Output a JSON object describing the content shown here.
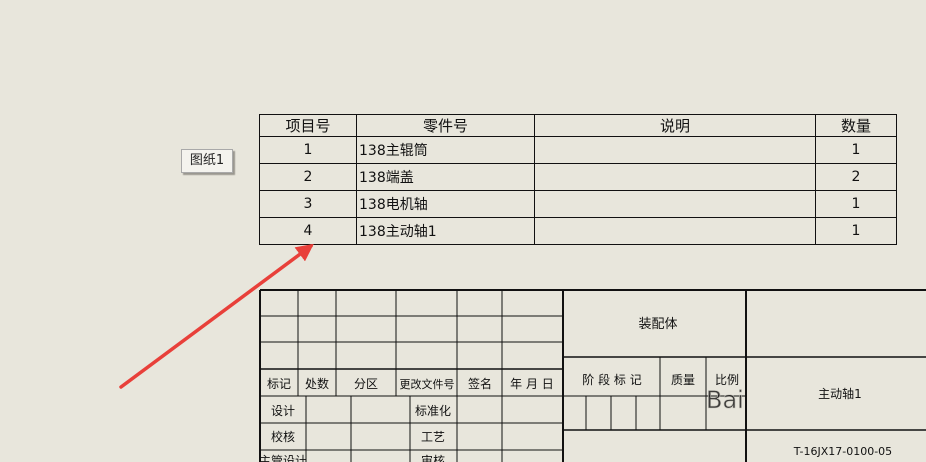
{
  "sheet_tab": {
    "label": "图纸1"
  },
  "bom": {
    "headers": [
      "项目号",
      "零件号",
      "说明",
      "数量"
    ],
    "rows": [
      {
        "item": "1",
        "part": "138主辊筒",
        "desc": "",
        "qty": "1"
      },
      {
        "item": "2",
        "part": "138端盖",
        "desc": "",
        "qty": "2"
      },
      {
        "item": "3",
        "part": "138电机轴",
        "desc": "",
        "qty": "1"
      },
      {
        "item": "4",
        "part": "138主动轴1",
        "desc": "",
        "qty": "1"
      }
    ]
  },
  "title_block": {
    "header_row": [
      "标记",
      "处数",
      "分区",
      "更改文件号",
      "签名",
      "年 月 日"
    ],
    "left_labels": [
      "设计",
      "校核",
      "主管设计"
    ],
    "mid_labels": [
      "标准化",
      "工艺",
      "审核"
    ],
    "assembly": "装配体",
    "stage_mark": "阶 段 标 记",
    "mass": "质量",
    "scale": "比例",
    "drawing_name": "主动轴1",
    "drawing_number": "T-16JX17-0100-05"
  },
  "watermark": {
    "text": "Bai"
  },
  "colors": {
    "background": "#e8e6dc",
    "lines": "#111111",
    "arrow": "#e8403a"
  }
}
